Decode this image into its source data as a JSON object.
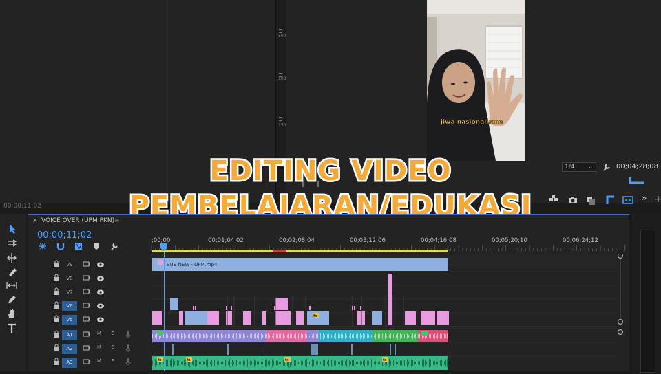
{
  "source_monitor": {
    "timecode": "00;00;11;02"
  },
  "program_monitor": {
    "vruler_labels": [
      "500",
      "1000",
      "1500"
    ],
    "caption": "jiwa nasionalisme",
    "zoom": "1/4",
    "timecode": "00;04;28;08"
  },
  "overlay_title": {
    "line1": "EDITING VIDEO",
    "line2": "PEMBELAJARAN/EDUKASI"
  },
  "sequence": {
    "close": "×",
    "tab_name": "VOICE OVER (UPM PKN)",
    "menu": "≡",
    "timecode": "00;00;11;02",
    "ruler_labels": [
      ";00;00",
      "00;01;04;02",
      "00;02;08;04",
      "00;03;12;06",
      "00;04;16;08",
      "00;05;20;10",
      "00;06;24;12"
    ],
    "video_tracks": [
      {
        "name": "V9",
        "targeted": false
      },
      {
        "name": "V8",
        "targeted": false
      },
      {
        "name": "V7",
        "targeted": false
      },
      {
        "name": "V6",
        "targeted": true
      },
      {
        "name": "V5",
        "targeted": true
      }
    ],
    "audio_tracks": [
      {
        "name": "A1",
        "m": "M",
        "s": "S"
      },
      {
        "name": "A2",
        "m": "M",
        "s": "S"
      },
      {
        "name": "A3",
        "m": "M",
        "s": "S"
      }
    ],
    "v9_clip_name": "SUB NEW - UPM.mp4",
    "fx_label": "fx"
  },
  "colors": {
    "accent": "#4e9eff",
    "title_fill": "#f2aa3a",
    "pink_clip": "#e89be0",
    "blue_clip": "#8fb0de",
    "audio_green": "#3ec48c"
  },
  "icons": [
    "selection-tool-icon",
    "track-select-icon",
    "ripple-edit-icon",
    "razor-icon",
    "slip-icon",
    "pen-icon",
    "hand-icon",
    "type-icon",
    "wrench-icon",
    "lock-icon",
    "eye-icon",
    "camera-icon",
    "mic-icon"
  ]
}
